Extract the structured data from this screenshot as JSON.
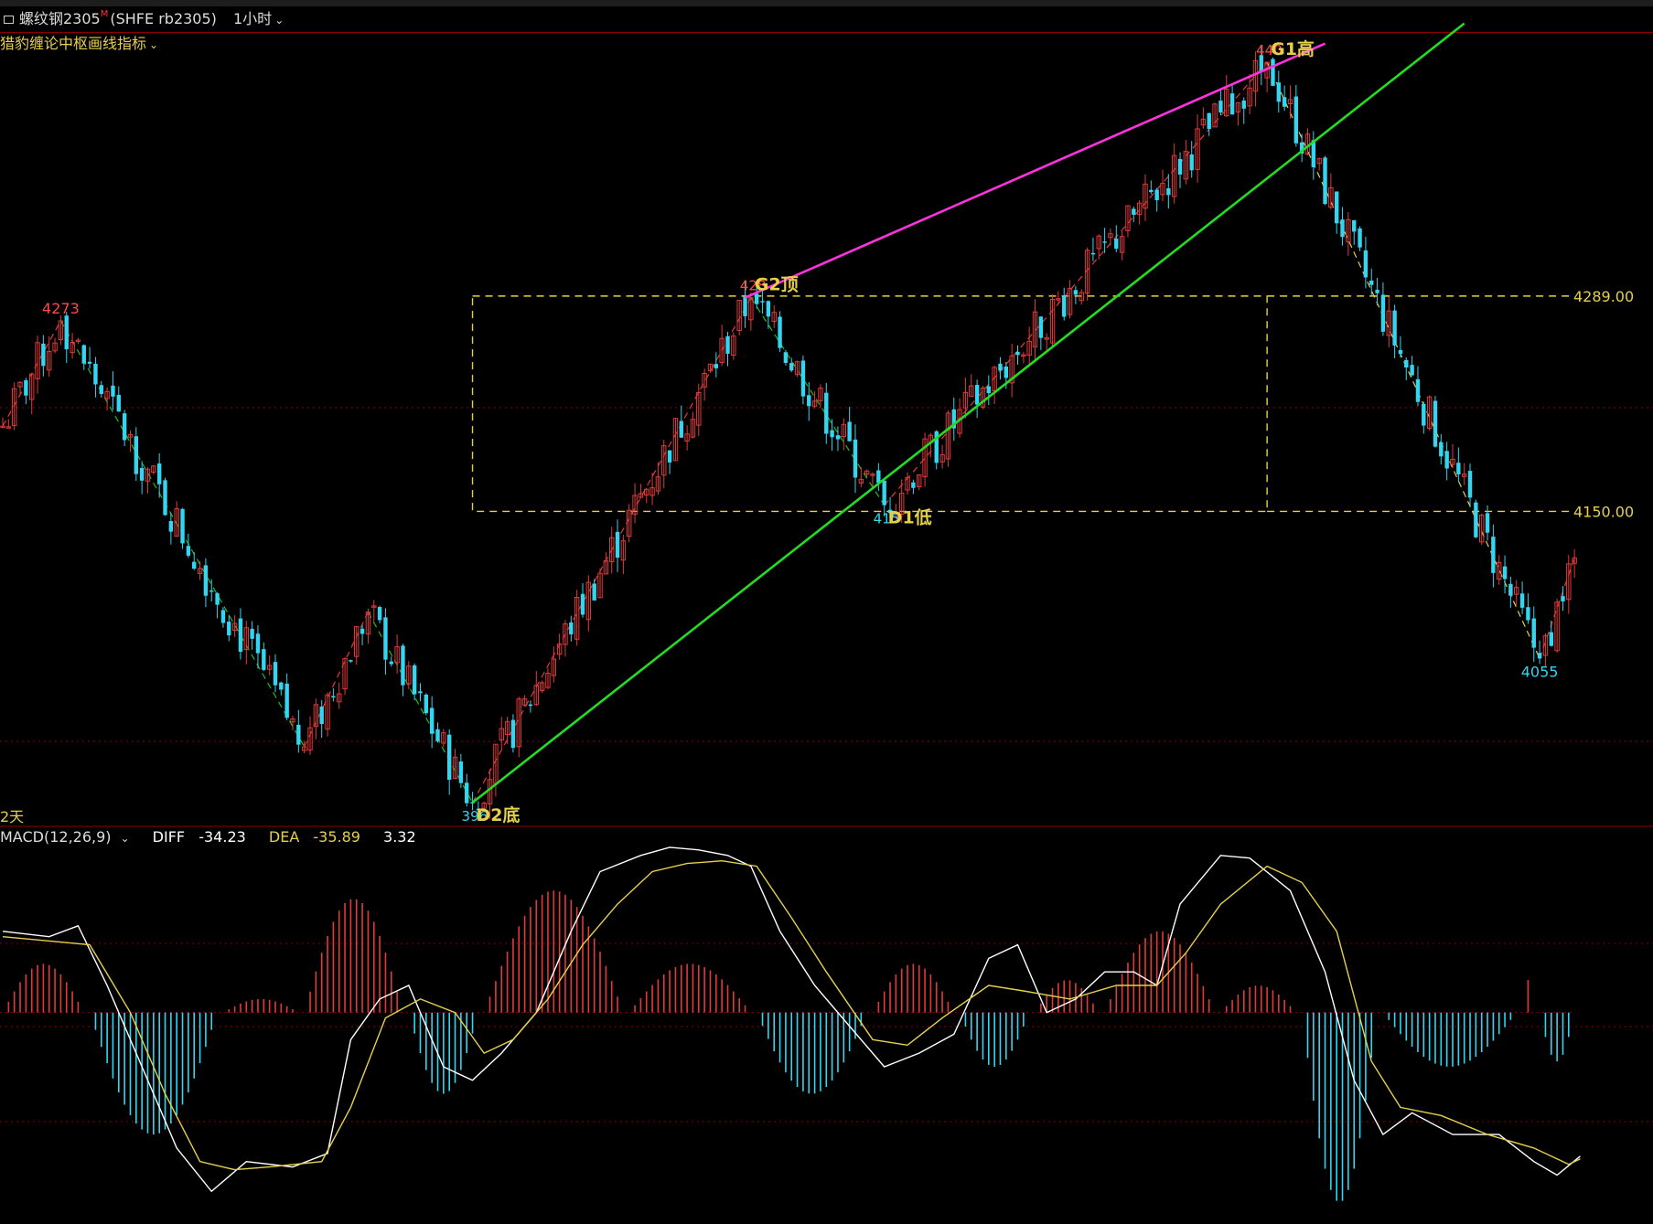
{
  "header": {
    "icon": "square-icon",
    "symbol": "螺纹钢2305",
    "symbol_suffix": "M",
    "code": "(SHFE rb2305)",
    "period": "1小时",
    "period_dropdown_icon": "chevron-down-icon"
  },
  "indicator": {
    "name": "猎豹缠论中枢画线指标",
    "dropdown_icon": "chevron-down-icon"
  },
  "status": {
    "days": "2天"
  },
  "macd": {
    "name": "MACD(12,26,9)",
    "dropdown_icon": "chevron-down-icon",
    "diff_label": "DIFF",
    "diff_value": "-34.23",
    "dea_label": "DEA",
    "dea_value": "-35.89",
    "macd_value": "3.32"
  },
  "colors": {
    "up": "#e03a3a",
    "down": "#33d5f0",
    "zone": "#e6d04a",
    "trend_green": "#22dd22",
    "trend_magenta": "#ff33dd",
    "grid": "#8b0000"
  },
  "chart_data": [
    {
      "type": "candlestick",
      "title": "螺纹钢2305 (SHFE rb2305) 1小时",
      "ylim": [
        3962,
        4440
      ],
      "price_levels": [
        {
          "label": "4289.00",
          "value": 4289
        },
        {
          "label": "4150.00",
          "value": 4150
        }
      ],
      "pivot_labels": [
        {
          "text": "4273",
          "kind": "high"
        },
        {
          "text": "G2顶",
          "prefix": "428",
          "kind": "high"
        },
        {
          "text": "D1低",
          "prefix": "415",
          "kind": "low"
        },
        {
          "text": "D2底",
          "prefix": "396",
          "kind": "low"
        },
        {
          "text": "G1高",
          "prefix": "440",
          "kind": "high"
        },
        {
          "text": "4055",
          "kind": "low"
        }
      ],
      "pivots": [
        {
          "bar": 0,
          "price": 4205
        },
        {
          "bar": 10,
          "price": 4273
        },
        {
          "bar": 52,
          "price": 3998
        },
        {
          "bar": 63,
          "price": 4085
        },
        {
          "bar": 81,
          "price": 3962
        },
        {
          "bar": 129,
          "price": 4288
        },
        {
          "bar": 152,
          "price": 4154
        },
        {
          "bar": 218,
          "price": 4440
        },
        {
          "bar": 265,
          "price": 4055
        },
        {
          "bar": 271,
          "price": 4120
        }
      ],
      "zone": {
        "start_bar": 81,
        "end_bar": 218,
        "high": 4289,
        "low": 4150
      },
      "trendlines": [
        {
          "name": "support",
          "from": {
            "bar": 81,
            "price": 3962
          },
          "to": {
            "bar": 252,
            "price": 4465
          }
        },
        {
          "name": "resistance",
          "from": {
            "bar": 128,
            "price": 4288
          },
          "to": {
            "bar": 228,
            "price": 4452
          }
        }
      ]
    },
    {
      "type": "line",
      "title": "MACD(12,26,9)",
      "ylim": [
        -75,
        65
      ],
      "series": [
        {
          "name": "DIFF",
          "points": [
            [
              0,
              30
            ],
            [
              8,
              28
            ],
            [
              13,
              32
            ],
            [
              18,
              10
            ],
            [
              24,
              -20
            ],
            [
              30,
              -50
            ],
            [
              36,
              -66
            ],
            [
              42,
              -55
            ],
            [
              50,
              -57
            ],
            [
              56,
              -52
            ],
            [
              60,
              -10
            ],
            [
              65,
              5
            ],
            [
              70,
              10
            ],
            [
              76,
              -20
            ],
            [
              81,
              -25
            ],
            [
              86,
              -15
            ],
            [
              92,
              0
            ],
            [
              98,
              30
            ],
            [
              103,
              52
            ],
            [
              110,
              58
            ],
            [
              115,
              61
            ],
            [
              120,
              60
            ],
            [
              125,
              58
            ],
            [
              129,
              54
            ],
            [
              134,
              30
            ],
            [
              140,
              10
            ],
            [
              146,
              -5
            ],
            [
              152,
              -20
            ],
            [
              158,
              -15
            ],
            [
              164,
              -8
            ],
            [
              170,
              20
            ],
            [
              175,
              25
            ],
            [
              180,
              0
            ],
            [
              185,
              5
            ],
            [
              190,
              15
            ],
            [
              195,
              15
            ],
            [
              199,
              10
            ],
            [
              203,
              40
            ],
            [
              210,
              58
            ],
            [
              215,
              57
            ],
            [
              222,
              45
            ],
            [
              228,
              15
            ],
            [
              233,
              -25
            ],
            [
              238,
              -45
            ],
            [
              243,
              -37
            ],
            [
              250,
              -45
            ],
            [
              258,
              -45
            ],
            [
              264,
              -55
            ],
            [
              268,
              -60
            ],
            [
              272,
              -53
            ]
          ]
        },
        {
          "name": "DEA",
          "points": [
            [
              0,
              28
            ],
            [
              10,
              26
            ],
            [
              15,
              25
            ],
            [
              22,
              0
            ],
            [
              28,
              -30
            ],
            [
              34,
              -55
            ],
            [
              40,
              -58
            ],
            [
              46,
              -57
            ],
            [
              55,
              -55
            ],
            [
              60,
              -35
            ],
            [
              66,
              -2
            ],
            [
              72,
              5
            ],
            [
              78,
              0
            ],
            [
              83,
              -15
            ],
            [
              88,
              -10
            ],
            [
              94,
              5
            ],
            [
              100,
              25
            ],
            [
              106,
              40
            ],
            [
              112,
              52
            ],
            [
              118,
              55
            ],
            [
              124,
              56
            ],
            [
              130,
              54
            ],
            [
              136,
              35
            ],
            [
              142,
              15
            ],
            [
              150,
              -10
            ],
            [
              156,
              -12
            ],
            [
              162,
              -2
            ],
            [
              170,
              10
            ],
            [
              176,
              8
            ],
            [
              184,
              5
            ],
            [
              192,
              10
            ],
            [
              199,
              10
            ],
            [
              204,
              22
            ],
            [
              210,
              40
            ],
            [
              218,
              54
            ],
            [
              224,
              48
            ],
            [
              230,
              30
            ],
            [
              236,
              -18
            ],
            [
              241,
              -35
            ],
            [
              248,
              -38
            ],
            [
              256,
              -45
            ],
            [
              264,
              -50
            ],
            [
              270,
              -56
            ],
            [
              272,
              -54
            ]
          ]
        }
      ],
      "histogram": [
        {
          "from_bar": 0,
          "to_bar": 15,
          "sign": "up",
          "peak": 18
        },
        {
          "from_bar": 15,
          "to_bar": 38,
          "sign": "down",
          "peak": -45
        },
        {
          "from_bar": 38,
          "to_bar": 52,
          "sign": "up",
          "peak": 5
        },
        {
          "from_bar": 52,
          "to_bar": 70,
          "sign": "up",
          "peak": 42
        },
        {
          "from_bar": 70,
          "to_bar": 83,
          "sign": "down",
          "peak": -30
        },
        {
          "from_bar": 83,
          "to_bar": 108,
          "sign": "up",
          "peak": 45
        },
        {
          "from_bar": 108,
          "to_bar": 130,
          "sign": "up",
          "peak": 18
        },
        {
          "from_bar": 130,
          "to_bar": 150,
          "sign": "down",
          "peak": -30
        },
        {
          "from_bar": 150,
          "to_bar": 165,
          "sign": "up",
          "peak": 18
        },
        {
          "from_bar": 165,
          "to_bar": 178,
          "sign": "down",
          "peak": -20
        },
        {
          "from_bar": 178,
          "to_bar": 190,
          "sign": "up",
          "peak": 12
        },
        {
          "from_bar": 190,
          "to_bar": 210,
          "sign": "up",
          "peak": 30
        },
        {
          "from_bar": 210,
          "to_bar": 224,
          "sign": "up",
          "peak": 10
        },
        {
          "from_bar": 224,
          "to_bar": 238,
          "sign": "down",
          "peak": -70
        },
        {
          "from_bar": 238,
          "to_bar": 262,
          "sign": "down",
          "peak": -20
        },
        {
          "from_bar": 262,
          "to_bar": 265,
          "sign": "up",
          "peak": 12
        },
        {
          "from_bar": 265,
          "to_bar": 272,
          "sign": "down",
          "peak": -18
        }
      ]
    }
  ]
}
